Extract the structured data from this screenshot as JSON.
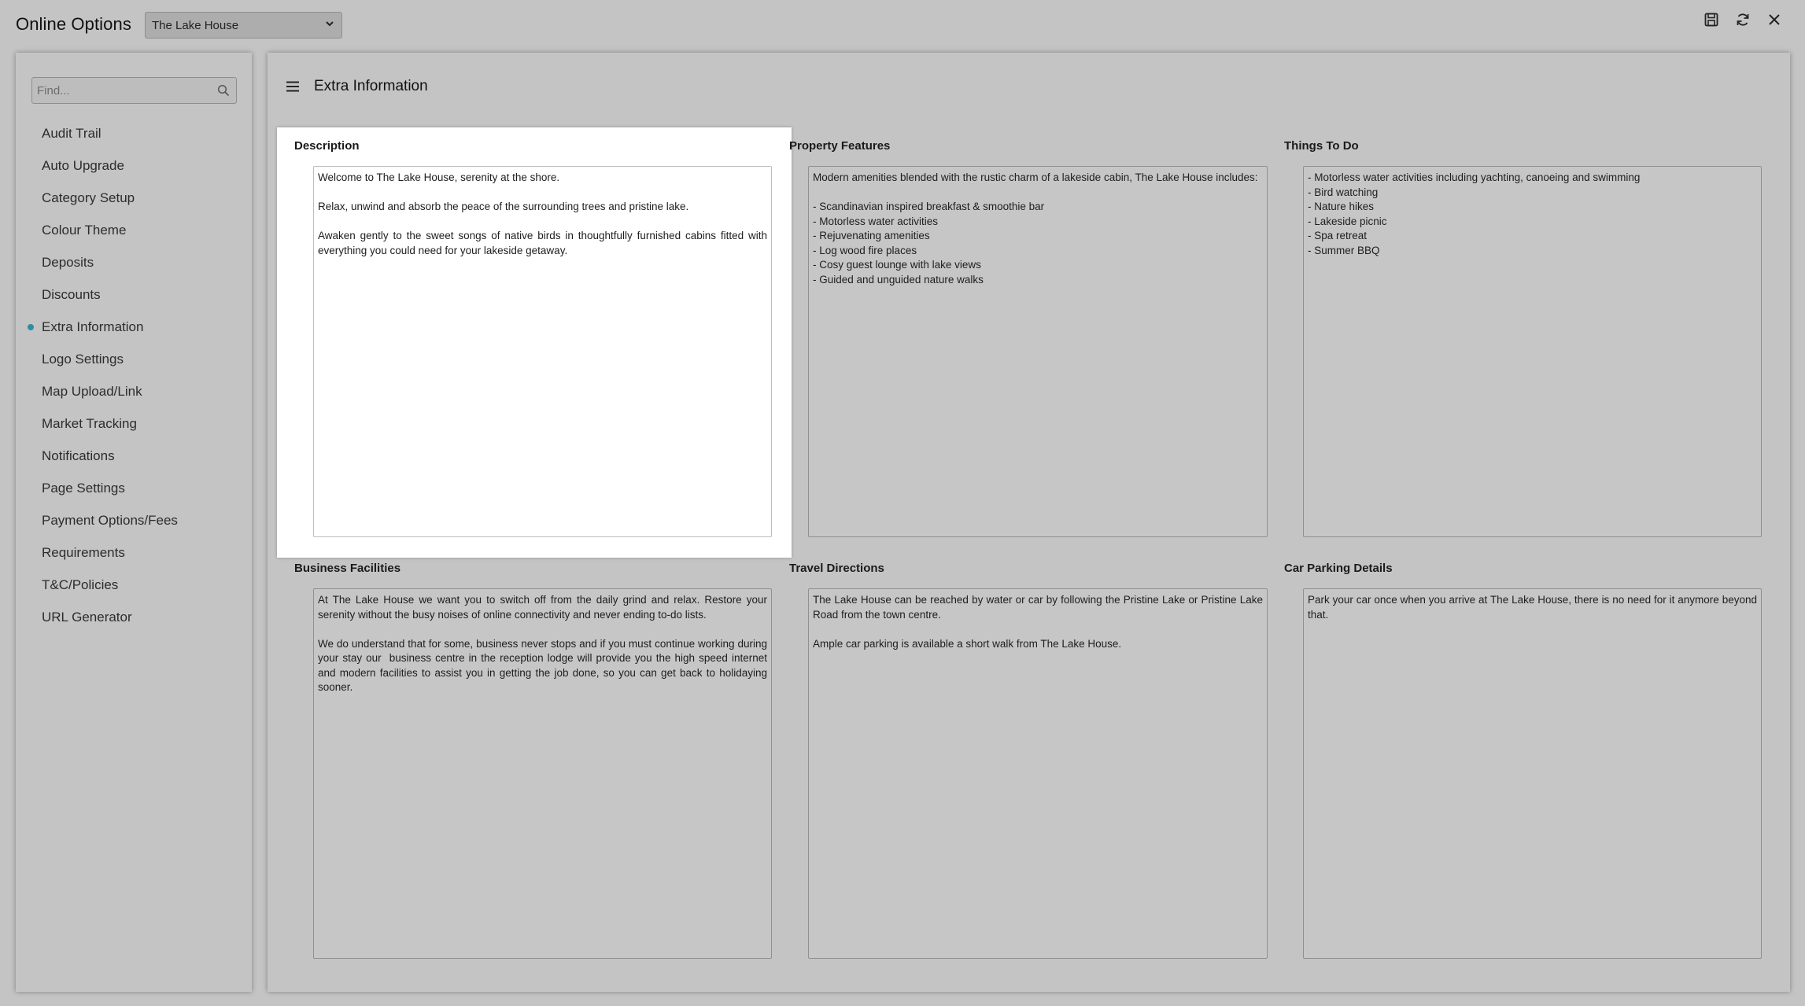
{
  "app": {
    "title": "Online Options",
    "property_selected": "The Lake House",
    "toolbar_icons": [
      "save-icon",
      "refresh-icon",
      "close-icon"
    ]
  },
  "sidebar": {
    "search_placeholder": "Find...",
    "active_item": "Extra Information",
    "accent_color": "#2a8fa3",
    "items": [
      {
        "label": "Audit Trail"
      },
      {
        "label": "Auto Upgrade"
      },
      {
        "label": "Category Setup"
      },
      {
        "label": "Colour Theme"
      },
      {
        "label": "Deposits"
      },
      {
        "label": "Discounts"
      },
      {
        "label": "Extra Information"
      },
      {
        "label": "Logo Settings"
      },
      {
        "label": "Map Upload/Link"
      },
      {
        "label": "Market Tracking"
      },
      {
        "label": "Notifications"
      },
      {
        "label": "Page Settings"
      },
      {
        "label": "Payment Options/Fees"
      },
      {
        "label": "Requirements"
      },
      {
        "label": "T&C/Policies"
      },
      {
        "label": "URL Generator"
      }
    ]
  },
  "main": {
    "title": "Extra Information",
    "fields": {
      "description": {
        "label": "Description",
        "value": "Welcome to The Lake House, serenity at the shore.\n\nRelax, unwind and absorb the peace of the surrounding trees and pristine lake.\n\nAwaken gently to the sweet songs of native birds in thoughtfully furnished cabins fitted with everything you could need for your lakeside getaway."
      },
      "property_features": {
        "label": "Property Features",
        "value": "Modern amenities blended with the rustic charm of a lakeside cabin, The Lake House includes:\n\n- Scandinavian inspired breakfast & smoothie bar\n- Motorless water activities\n- Rejuvenating amenities\n- Log wood fire places\n- Cosy guest lounge with lake views\n- Guided and unguided nature walks"
      },
      "things_to_do": {
        "label": "Things To Do",
        "value": "- Motorless water activities including yachting, canoeing and swimming\n- Bird watching\n- Nature hikes\n- Lakeside picnic\n- Spa retreat\n- Summer BBQ"
      },
      "business_facilities": {
        "label": "Business Facilities",
        "value": "At The Lake House we want you to switch off from the daily grind and relax. Restore your serenity without the busy noises of online connectivity and never ending to-do lists.\n\nWe do understand that for some, business never stops and if you must continue working during your stay our  business centre in the reception lodge will provide you the high speed internet and modern facilities to assist you in getting the job done, so you can get back to holidaying sooner."
      },
      "travel_directions": {
        "label": "Travel Directions",
        "value": "The Lake House can be reached by water or car by following the Pristine Lake or Pristine Lake Road from the town centre.\n\nAmple car parking is available a short walk from The Lake House."
      },
      "car_parking": {
        "label": "Car Parking Details",
        "value": "Park your car once when you arrive at The Lake House, there is no need for it anymore beyond that."
      }
    }
  }
}
